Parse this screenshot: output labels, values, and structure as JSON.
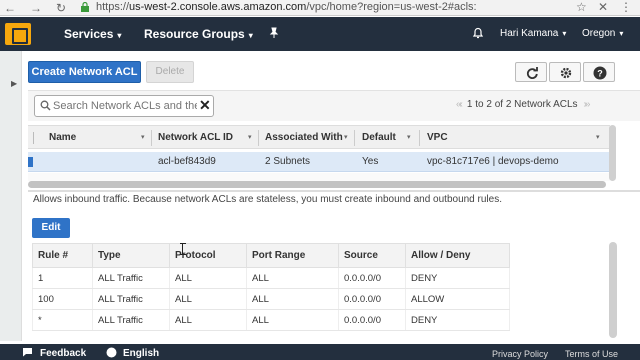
{
  "browser": {
    "url_prefix": "https://",
    "url_host": "us-west-2.console.aws.amazon.com",
    "url_path": "/vpc/home?region=us-west-2#acls:"
  },
  "topnav": {
    "services_label": "Services",
    "resource_groups_label": "Resource Groups",
    "user_label": "Hari Kamana",
    "region_label": "Oregon"
  },
  "toolbar": {
    "create_label": "Create Network ACL",
    "delete_label": "Delete"
  },
  "search": {
    "placeholder": "Search Network ACLs and their p",
    "pager_text": "1 to 2 of 2 Network ACLs"
  },
  "acl_table": {
    "columns": [
      "Name",
      "Network ACL ID",
      "Associated With",
      "Default",
      "VPC"
    ],
    "rows": [
      {
        "name": "",
        "acl_id": "acl-bef843d9",
        "associated": "2 Subnets",
        "default": "Yes",
        "vpc": "vpc-81c717e6 | devops-demo"
      }
    ]
  },
  "details": {
    "info_text": "Allows inbound traffic. Because network ACLs are stateless, you must create inbound and outbound rules.",
    "edit_label": "Edit",
    "rules_columns": [
      "Rule #",
      "Type",
      "Protocol",
      "Port Range",
      "Source",
      "Allow / Deny"
    ],
    "rules": [
      {
        "rule": "1",
        "type": "ALL Traffic",
        "protocol": "ALL",
        "port": "ALL",
        "source": "0.0.0.0/0",
        "action": "DENY"
      },
      {
        "rule": "100",
        "type": "ALL Traffic",
        "protocol": "ALL",
        "port": "ALL",
        "source": "0.0.0.0/0",
        "action": "ALLOW"
      },
      {
        "rule": "*",
        "type": "ALL Traffic",
        "protocol": "ALL",
        "port": "ALL",
        "source": "0.0.0.0/0",
        "action": "DENY"
      }
    ]
  },
  "footer": {
    "feedback_label": "Feedback",
    "language_label": "English",
    "privacy_label": "Privacy Policy",
    "terms_label": "Terms of Use"
  },
  "colors": {
    "aws_nav": "#232f3e",
    "primary_button": "#2f73c7",
    "deny": "#d13212",
    "allow": "#3b8a1a",
    "selected_row": "#dde9f7"
  }
}
